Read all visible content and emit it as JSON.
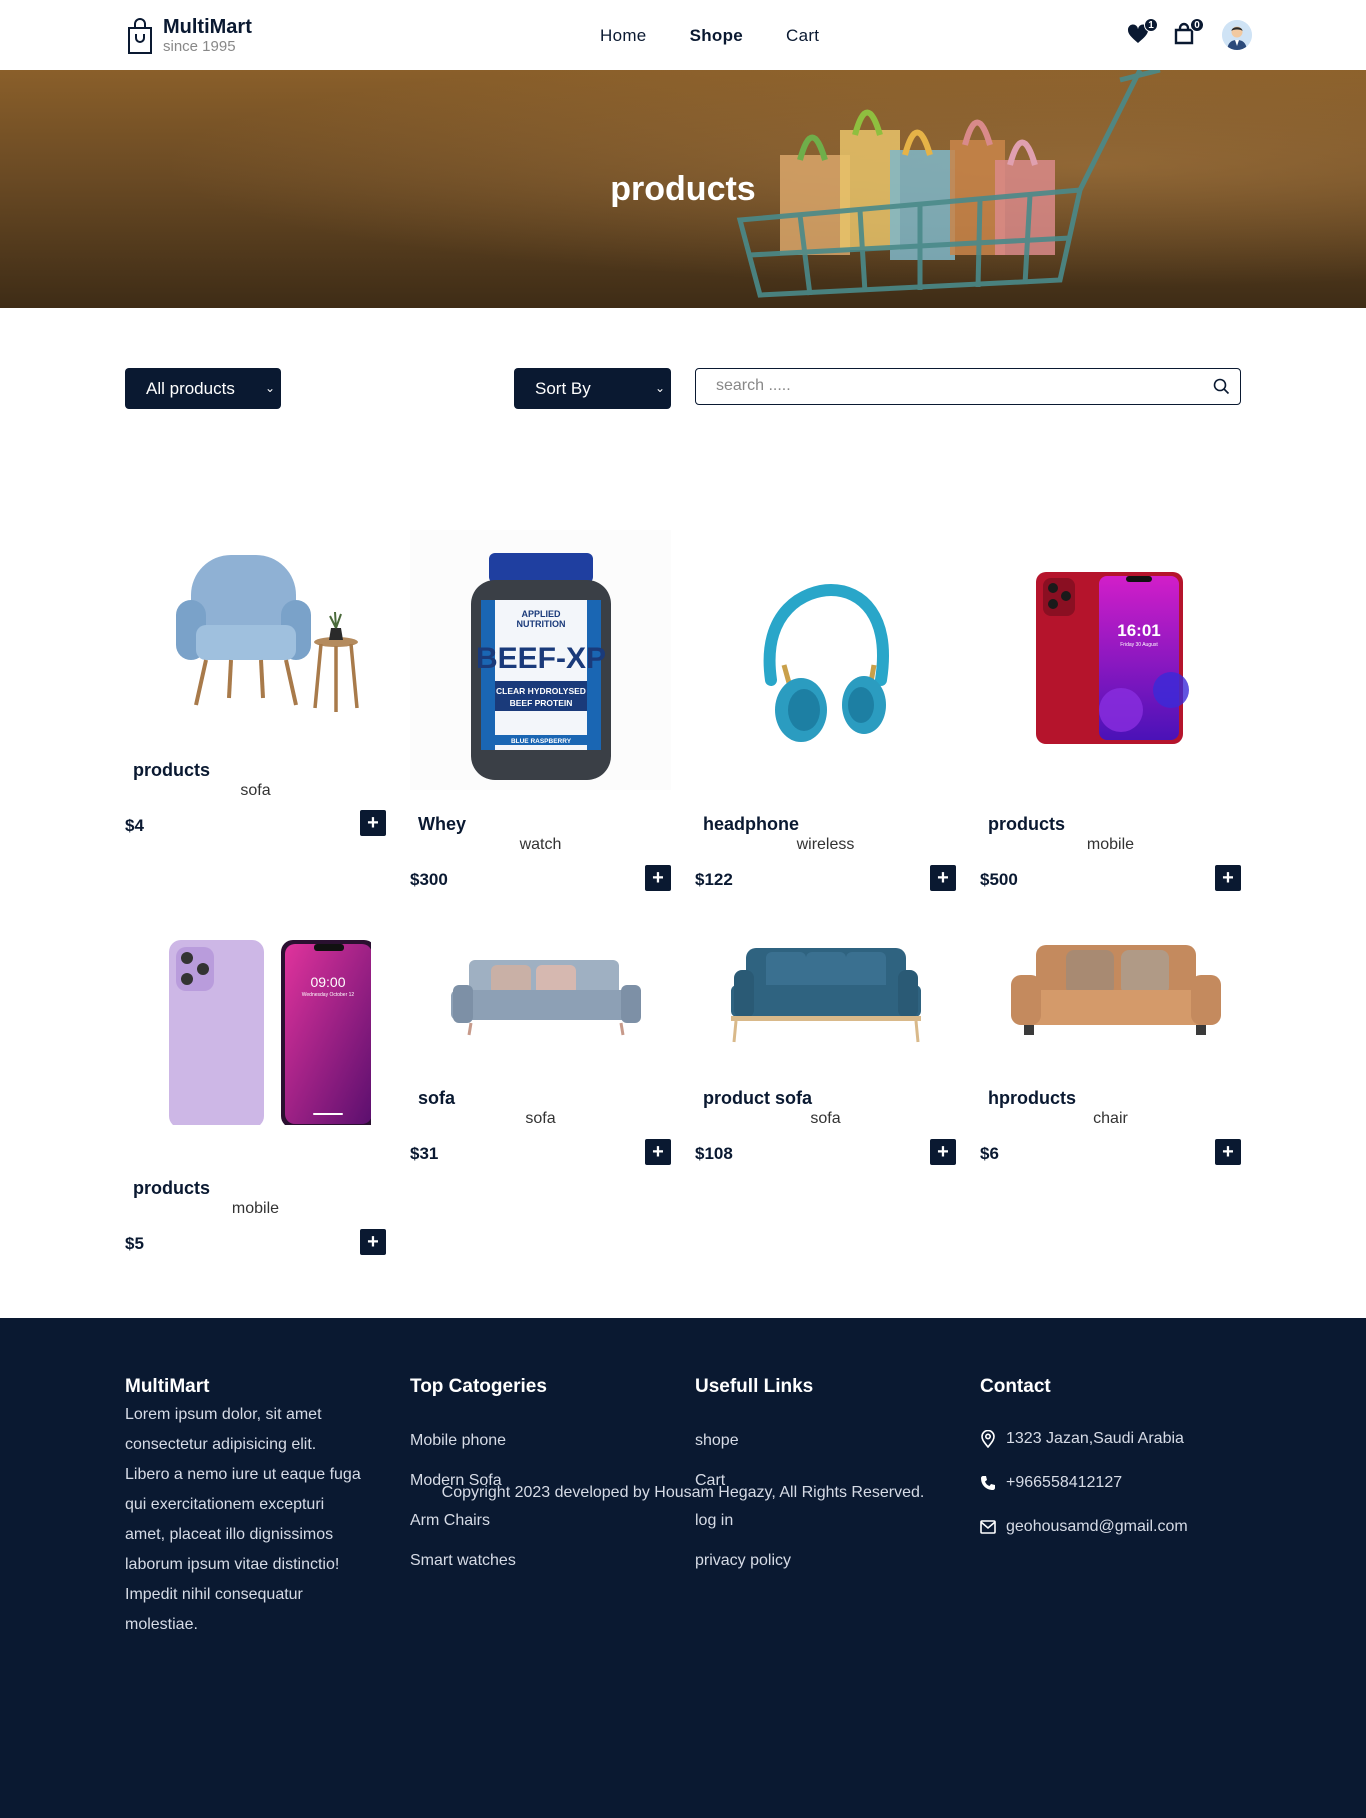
{
  "brand": {
    "name": "MultiMart",
    "tagline": "since 1995"
  },
  "nav": {
    "home": "Home",
    "shop": "Shope",
    "cart": "Cart"
  },
  "header_icons": {
    "wishlist_count": "1",
    "cart_count": "0",
    "wishlist_icon": "heart-icon",
    "cart_icon": "shopping-bag-icon",
    "profile_icon": "user-avatar"
  },
  "hero": {
    "title": "products"
  },
  "filters": {
    "category": "All products",
    "sort": "Sort By",
    "search_placeholder": "search ....."
  },
  "products": [
    {
      "name": "products",
      "category": "sofa",
      "price": "$4",
      "image": "armchair"
    },
    {
      "name": "Whey",
      "category": "watch",
      "price": "$300",
      "image": "protein-tub"
    },
    {
      "name": "headphone",
      "category": "wireless",
      "price": "$122",
      "image": "headphones"
    },
    {
      "name": "products",
      "category": "mobile",
      "price": "$500",
      "image": "red-phone"
    },
    {
      "name": "products",
      "category": "mobile",
      "price": "$5",
      "image": "purple-phone"
    },
    {
      "name": "sofa",
      "category": "sofa",
      "price": "$31",
      "image": "grey-sofa"
    },
    {
      "name": "product sofa",
      "category": "sofa",
      "price": "$108",
      "image": "blue-sofa"
    },
    {
      "name": "hproducts",
      "category": "chair",
      "price": "$6",
      "image": "tan-sofa"
    }
  ],
  "product_images": {
    "whey": {
      "brand_line1": "APPLIED",
      "brand_line2": "NUTRITION",
      "title": "BEEF-XP",
      "line1": "CLEAR HYDROLYSED",
      "line2": "BEEF PROTEIN",
      "flavor": "BLUE RASPBERRY"
    },
    "red_phone": {
      "time": "16:01",
      "date": "Friday 30 August"
    },
    "purple_phone": {
      "time": "09:00",
      "date": "Wednesday October 12"
    }
  },
  "footer": {
    "brand": "MultiMart",
    "about": "Lorem ipsum dolor, sit amet consectetur adipisicing elit. Libero a nemo iure ut eaque fuga qui exercitationem excepturi amet, placeat illo dignissimos laborum ipsum vitae distinctio! Impedit nihil consequatur molestiae.",
    "categories_title": "Top Catogeries",
    "categories": [
      "Mobile phone",
      "Modern Sofa",
      "Arm Chairs",
      "Smart watches"
    ],
    "links_title": "Usefull Links",
    "links": [
      "shope",
      "Cart",
      "log in",
      "privacy policy"
    ],
    "contact_title": "Contact",
    "address": "1323 Jazan,Saudi Arabia",
    "phone": "+966558412127",
    "email": "geohousamd@gmail.com",
    "copyright": "Copyright 2023 developed by Housam Hegazy, All Rights Reserved."
  },
  "colors": {
    "primary": "#0a1931",
    "hero_top": "#8a5f2a",
    "hero_bottom": "#3e2c16"
  }
}
